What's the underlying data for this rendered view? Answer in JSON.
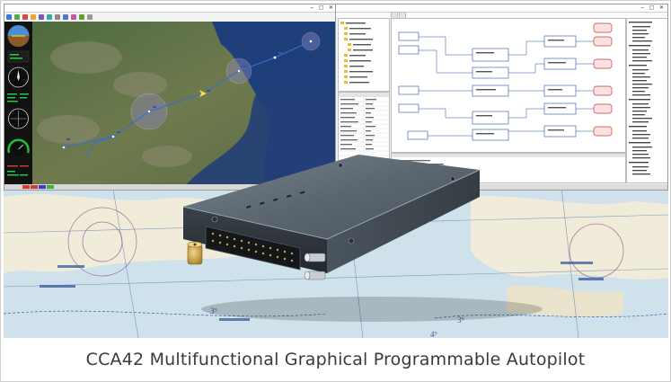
{
  "caption": "CCA42 Multifunctional Graphical Programmable Autopilot",
  "product": {
    "name": "CCA42",
    "category": "Multifunctional Graphical Programmable Autopilot"
  },
  "colors": {
    "caption_text": "#3a3a3a",
    "device_body": "#5b6670",
    "device_face": "#2f3439",
    "sma_connector": "#c9a24a",
    "chart_water": "#cfe1ea",
    "chart_land": "#f1ecd9",
    "flight_path": "#3d6bd1",
    "block_red": "#d23a3a"
  },
  "icons": {
    "window_controls": "minimize-maximize-close-icons",
    "attitude_indicator": "attitude-indicator-icon",
    "heading_indicator": "heading-indicator-icon",
    "airspeed_gauge": "airspeed-gauge-icon",
    "sma_antenna_port": "sma-connector-icon",
    "air_pressure_ports": "pitot-static-port-icon",
    "multi_pin_connector": "pin-connector-icon"
  }
}
